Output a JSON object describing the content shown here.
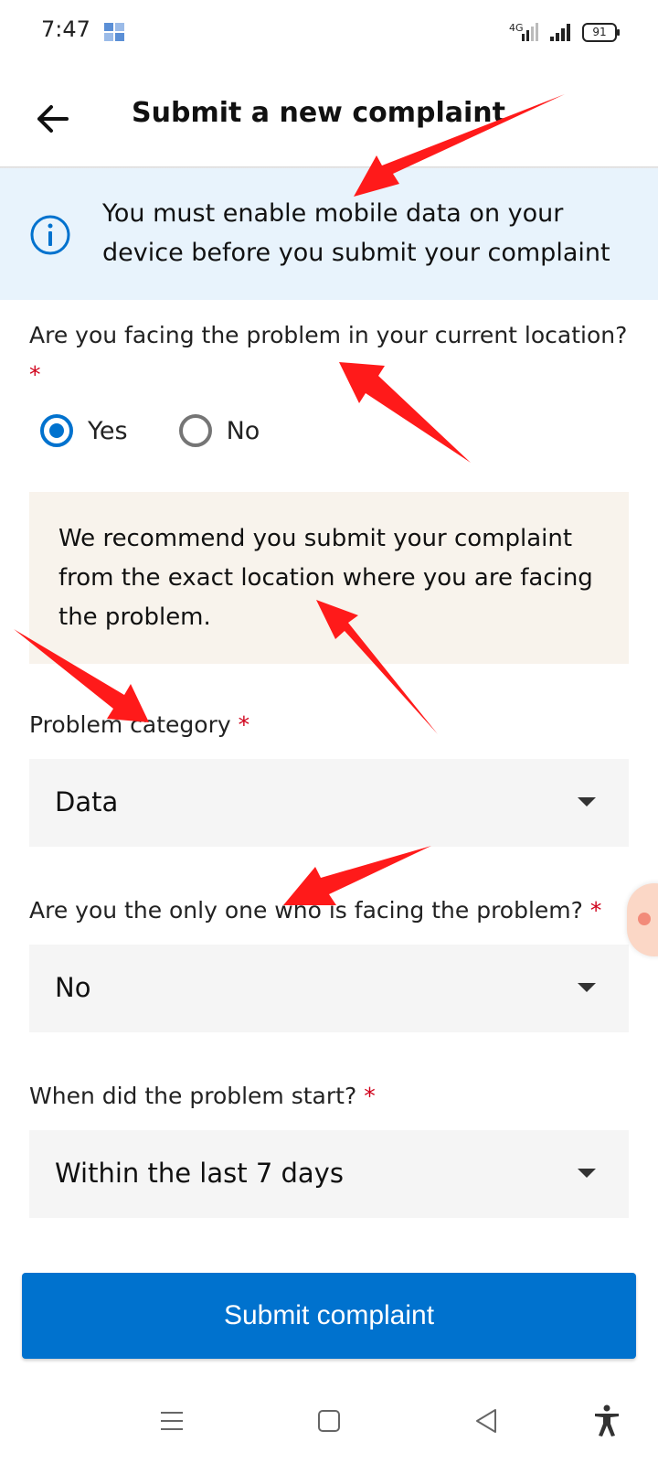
{
  "status_bar": {
    "time": "7:47",
    "network": "4G",
    "battery": "91"
  },
  "header": {
    "title": "Submit a new complaint",
    "back_icon": "arrow-left-icon"
  },
  "info_banner": {
    "icon": "info-icon",
    "text": "You must enable mobile data on your device before you submit your complaint"
  },
  "location_question": {
    "label": "Are you facing the problem in your current location?",
    "required_mark": "*",
    "options": [
      {
        "label": "Yes",
        "selected": true
      },
      {
        "label": "No",
        "selected": false
      }
    ]
  },
  "recommendation": {
    "text": "We recommend you submit your complaint from the exact location where you are facing the problem."
  },
  "fields": [
    {
      "label": "Problem category",
      "required_mark": "*",
      "value": "Data"
    },
    {
      "label": "Are you the only one who is facing the problem?",
      "required_mark": "*",
      "value": "No"
    },
    {
      "label": "When did the problem start?",
      "required_mark": "*",
      "value": "Within the last 7 days"
    }
  ],
  "submit": {
    "label": "Submit complaint"
  },
  "nav_bar": {
    "items": [
      "menu-icon",
      "home-square-icon",
      "back-triangle-icon",
      "accessibility-icon"
    ]
  },
  "colors": {
    "accent": "#0072ce",
    "info_bg": "#e8f3fc",
    "recommend_bg": "#f8f3ec",
    "field_bg": "#f5f5f5",
    "required": "#d0021b",
    "annotation_arrow": "#ff1a1a"
  }
}
